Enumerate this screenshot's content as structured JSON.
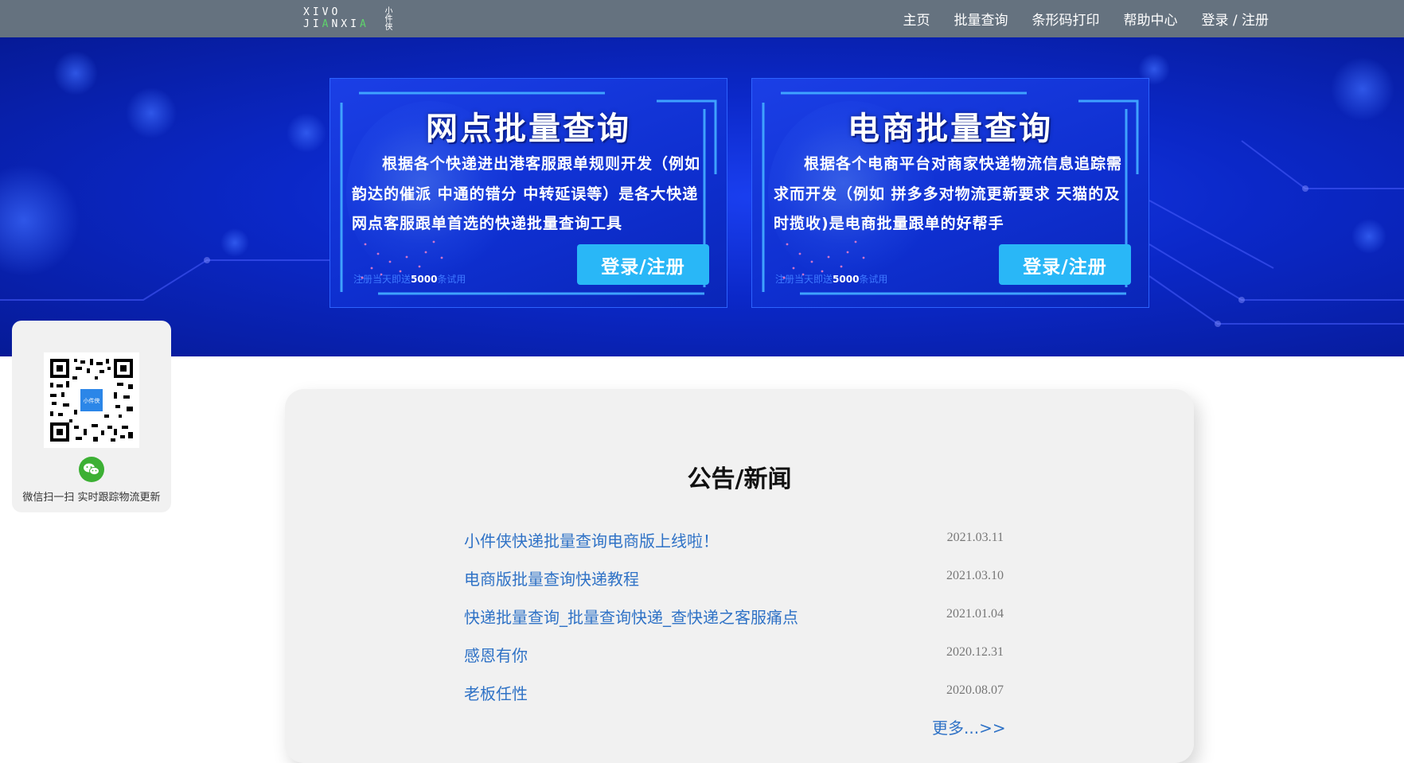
{
  "logo": {
    "row1": "XIVO",
    "row2_a": "JI",
    "row2_b": "A",
    "row2_c": "NXI",
    "row2_d": "A",
    "cn": "小件侠"
  },
  "nav": {
    "items": [
      "主页",
      "批量查询",
      "条形码打印",
      "帮助中心",
      "登录 / 注册"
    ]
  },
  "cards": [
    {
      "title": "网点批量查询",
      "desc": "根据各个快递进出港客服跟单规则开发（例如韵达的催派 中通的错分 中转延误等）是各大快递网点客服跟单首选的快递批量查询工具",
      "button": "登录/注册",
      "trial_pre": "注册当天即送",
      "trial_num": "5000",
      "trial_post": "条试用"
    },
    {
      "title": "电商批量查询",
      "desc": "根据各个电商平台对商家快递物流信息追踪需求而开发（例如 拼多多对物流更新要求 天猫的及时揽收)是电商批量跟单的好帮手",
      "button": "登录/注册",
      "trial_pre": "注册当天即送",
      "trial_num": "5000",
      "trial_post": "条试用"
    }
  ],
  "qr": {
    "caption": "微信扫一扫 实时跟踪物流更新"
  },
  "news": {
    "title": "公告/新闻",
    "items": [
      {
        "title": "小件侠快递批量查询电商版上线啦！",
        "date": "2021.03.11"
      },
      {
        "title": "电商版批量查询快递教程",
        "date": "2021.03.10"
      },
      {
        "title": "快递批量查询_批量查询快递_查快递之客服痛点",
        "date": "2021.01.04"
      },
      {
        "title": "感恩有你",
        "date": "2020.12.31"
      },
      {
        "title": "老板任性",
        "date": "2020.08.07"
      }
    ],
    "more": "更多...>>"
  },
  "colors": {
    "topbar": "#65727f",
    "banner": "#0b28c8",
    "accent_button": "#29b7f7",
    "link": "#2f72c6"
  }
}
